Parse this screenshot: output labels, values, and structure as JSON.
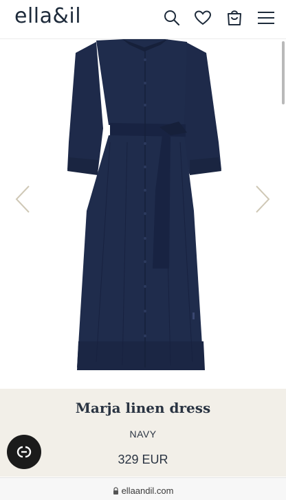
{
  "header": {
    "logo": "ella&il",
    "icons": [
      "search-icon",
      "heart-icon",
      "shopping-bag-icon",
      "menu-icon"
    ]
  },
  "product": {
    "name": "Marja linen dress",
    "color": "NAVY",
    "price": "329 EUR"
  },
  "browser": {
    "url": "ellaandil.com"
  },
  "colors": {
    "dress": "#1e2a4a",
    "info_bg": "#f2efe8",
    "text": "#2a3442"
  }
}
